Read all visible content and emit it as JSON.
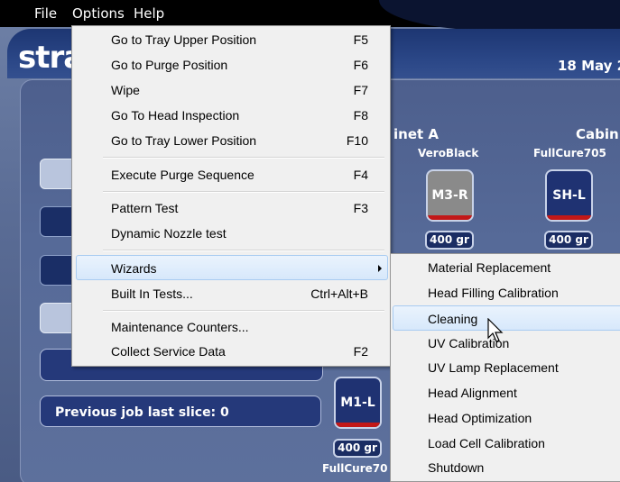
{
  "menubar": {
    "file": "File",
    "options": "Options",
    "help": "Help"
  },
  "app": {
    "logo": "stra",
    "date": "18 May 2",
    "cabinet_a": "inet A",
    "cabinet_b": "Cabin",
    "previous_job": "Previous job last slice: 0",
    "cartridges": [
      {
        "material": "VeroBlack",
        "slot": "M3-R",
        "weight": "400 gr",
        "color": "#8a8a8a"
      },
      {
        "material": "FullCure705",
        "slot": "SH-L",
        "weight": "400 gr",
        "color": "#1f3272"
      },
      {
        "material": "FullCure70",
        "slot": "M1-L",
        "weight": "400 gr",
        "color": "#1f3272"
      }
    ]
  },
  "options_menu": {
    "items": [
      {
        "label": "Go to Tray Upper Position",
        "shortcut": "F5"
      },
      {
        "label": "Go to Purge Position",
        "shortcut": "F6"
      },
      {
        "label": "Wipe",
        "shortcut": "F7"
      },
      {
        "label": "Go To Head Inspection",
        "shortcut": "F8"
      },
      {
        "label": "Go to Tray Lower Position",
        "shortcut": "F10"
      },
      {
        "label": "Execute Purge Sequence",
        "shortcut": "F4"
      },
      {
        "label": "Pattern Test",
        "shortcut": "F3"
      },
      {
        "label": "Dynamic Nozzle test",
        "shortcut": ""
      },
      {
        "label": "Wizards",
        "shortcut": ""
      },
      {
        "label": "Built In Tests...",
        "shortcut": "Ctrl+Alt+B"
      },
      {
        "label": "Maintenance Counters...",
        "shortcut": ""
      },
      {
        "label": "Collect Service Data",
        "shortcut": "F2"
      }
    ]
  },
  "wizards_menu": {
    "items": [
      "Material Replacement",
      "Head Filling Calibration",
      "Cleaning",
      "UV Calibration",
      "UV Lamp Replacement",
      "Head Alignment",
      "Head Optimization",
      "Load Cell Calibration",
      "Shutdown"
    ]
  },
  "colors": {
    "menu_bg": "#f0f0f0",
    "highlight_border": "#a8cbf1",
    "app_panel": "#4d5f8d",
    "cartridge_red": "#c21818"
  }
}
